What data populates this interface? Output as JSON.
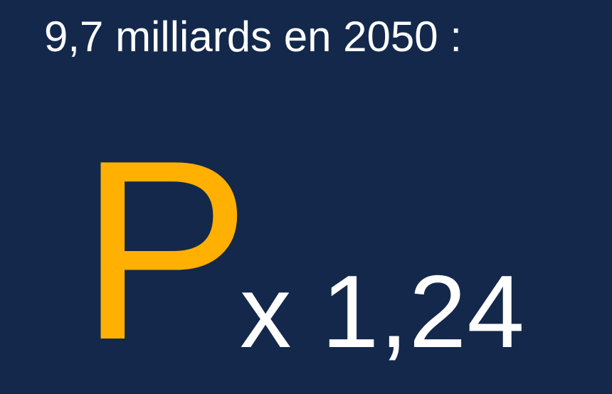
{
  "slide": {
    "headline": "9,7 milliards en 2050 :",
    "variable": "P",
    "multiplier": "x 1,24",
    "colors": {
      "background": "#13284b",
      "accent": "#ffb000",
      "text": "#ffffff"
    }
  }
}
